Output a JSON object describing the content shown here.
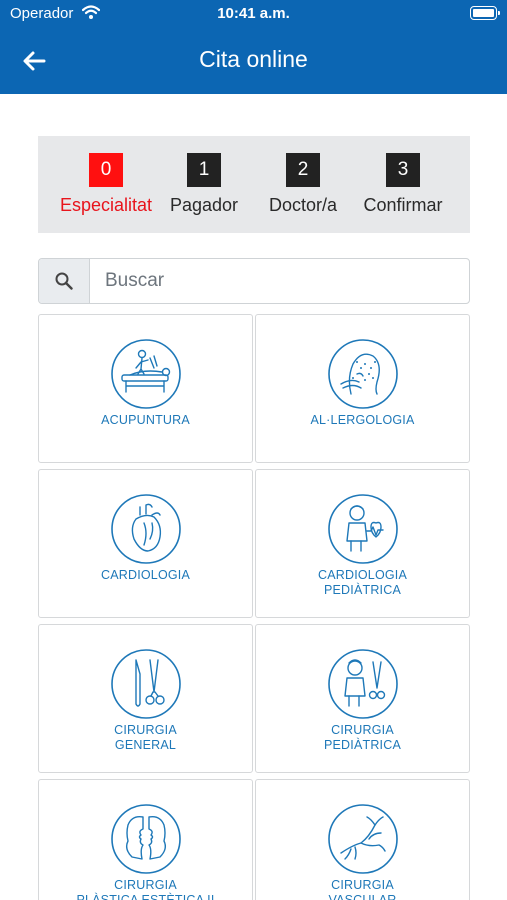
{
  "status_bar": {
    "carrier": "Operador",
    "time": "10:41 a.m."
  },
  "nav": {
    "title": "Cita online",
    "back_icon": "arrow-left-icon"
  },
  "steps": [
    {
      "number": "0",
      "label": "Especialitat",
      "active": true
    },
    {
      "number": "1",
      "label": "Pagador",
      "active": false
    },
    {
      "number": "2",
      "label": "Doctor/a",
      "active": false
    },
    {
      "number": "3",
      "label": "Confirmar",
      "active": false
    }
  ],
  "search": {
    "placeholder": "Buscar",
    "value": "",
    "icon": "search-icon"
  },
  "specialties": [
    {
      "label": "ACUPUNTURA",
      "icon": "acupuncture-icon"
    },
    {
      "label": "AL·LERGOLOGIA",
      "icon": "allergy-icon"
    },
    {
      "label": "CARDIOLOGIA",
      "icon": "heart-icon"
    },
    {
      "label": "CARDIOLOGIA\nPEDIÀTRICA",
      "icon": "child-heart-icon"
    },
    {
      "label": "CIRURGIA\nGENERAL",
      "icon": "surgery-tools-icon"
    },
    {
      "label": "CIRURGIA\nPEDIÀTRICA",
      "icon": "child-surgery-icon"
    },
    {
      "label": "CIRURGIA\nPLÀSTICA ESTÈTICA II",
      "icon": "faces-profile-icon"
    },
    {
      "label": "CIRURGIA\nVASCULAR",
      "icon": "vessels-icon"
    }
  ],
  "colors": {
    "header": "#0c66b3",
    "active_step": "#ff1010",
    "accent_text": "#1e78b8"
  }
}
